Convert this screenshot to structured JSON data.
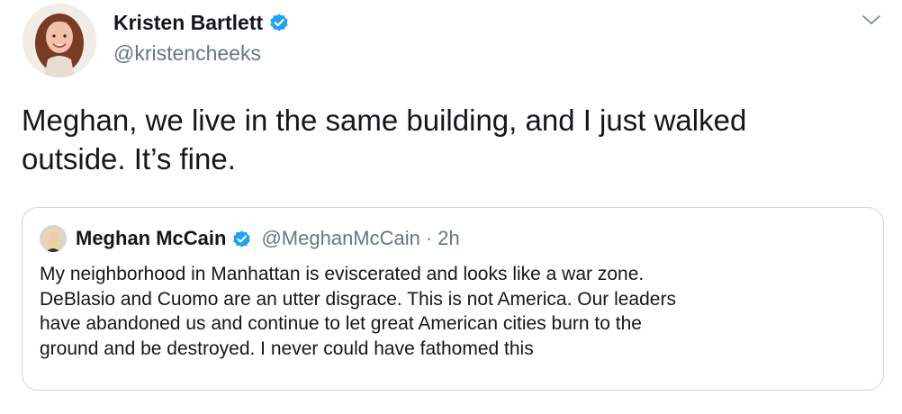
{
  "tweet": {
    "author": {
      "display_name": "Kristen Bartlett",
      "handle": "@kristencheeks",
      "verified": true
    },
    "text_line1": "Meghan, we live in the same building, and I just walked",
    "text_line2": "outside. It’s fine.",
    "menu_icon": "chevron-down-icon"
  },
  "quoted_tweet": {
    "author": {
      "display_name": "Meghan McCain",
      "handle": "@MeghanMcCain",
      "verified": true
    },
    "separator": "·",
    "time": "2h",
    "lines": [
      "My neighborhood in Manhattan is eviscerated and looks like a war zone.",
      "DeBlasio and Cuomo are an utter disgrace. This is not America. Our leaders",
      "have abandoned us and continue to let great American cities burn to the",
      "ground and be destroyed. I never could have fathomed this"
    ]
  },
  "colors": {
    "text": "#14171a",
    "secondary": "#657786",
    "verified": "#1da1f2",
    "border": "#ccd6dd"
  }
}
